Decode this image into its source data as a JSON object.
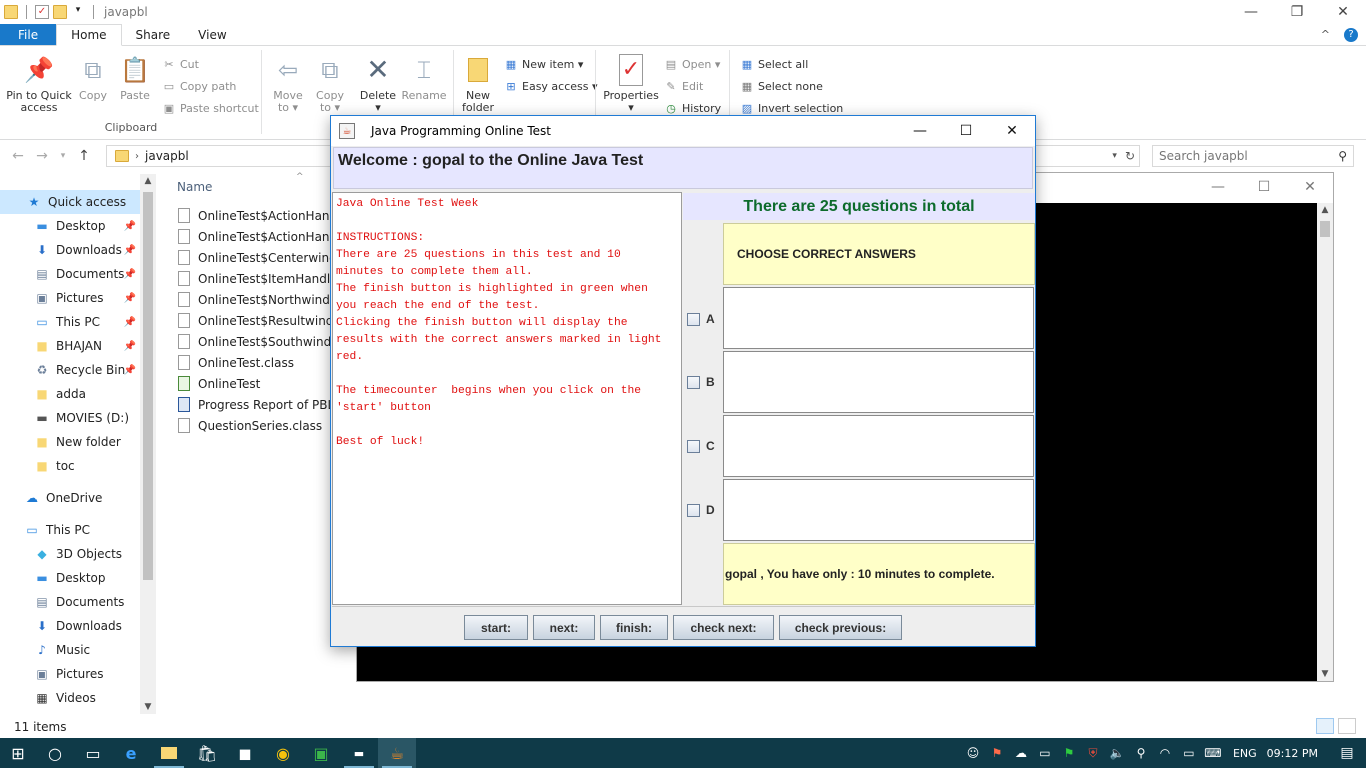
{
  "explorer": {
    "title": "javapbl",
    "tabs": [
      {
        "label": "File"
      },
      {
        "label": "Home"
      },
      {
        "label": "Share"
      },
      {
        "label": "View"
      }
    ],
    "ribbon": {
      "clipboard": {
        "label": "Clipboard",
        "pin": "Pin to Quick\naccess",
        "copy": "Copy",
        "paste": "Paste",
        "cut": "Cut",
        "copy_path": "Copy path",
        "paste_shortcut": "Paste shortcut"
      },
      "organize": {
        "move_to": "Move\nto ▾",
        "copy_to": "Copy\nto ▾",
        "delete": "Delete\n▾",
        "rename": "Rename"
      },
      "new": {
        "new_folder": "New\nfolder",
        "new_item": "New item ▾",
        "easy_access": "Easy access ▾"
      },
      "open": {
        "properties": "Properties\n▾",
        "open": "Open ▾",
        "edit": "Edit",
        "history": "History"
      },
      "select": {
        "select_all": "Select all",
        "select_none": "Select none",
        "invert_selection": "Invert selection"
      }
    },
    "address": {
      "path": "javapbl",
      "search_placeholder": "Search javapbl"
    },
    "nav": [
      {
        "label": "Quick access",
        "icon": "star-icon"
      },
      {
        "label": "Desktop",
        "icon": "desktop-icon"
      },
      {
        "label": "Downloads",
        "icon": "download-icon"
      },
      {
        "label": "Documents",
        "icon": "document-icon"
      },
      {
        "label": "Pictures",
        "icon": "pictures-icon"
      },
      {
        "label": "This PC",
        "icon": "computer-icon"
      },
      {
        "label": "BHAJAN",
        "icon": "folder-icon"
      },
      {
        "label": "Recycle Bin",
        "icon": "recycle-bin-icon"
      },
      {
        "label": "adda",
        "icon": "folder-icon"
      },
      {
        "label": "MOVIES (D:)",
        "icon": "drive-icon"
      },
      {
        "label": "New folder",
        "icon": "folder-icon"
      },
      {
        "label": "toc",
        "icon": "folder-icon"
      },
      {
        "label": "OneDrive",
        "icon": "cloud-icon"
      },
      {
        "label": "This PC",
        "icon": "computer-icon"
      },
      {
        "label": "3D Objects",
        "icon": "cube-icon"
      },
      {
        "label": "Desktop",
        "icon": "desktop-icon"
      },
      {
        "label": "Documents",
        "icon": "document-icon"
      },
      {
        "label": "Downloads",
        "icon": "download-icon"
      },
      {
        "label": "Music",
        "icon": "music-icon"
      },
      {
        "label": "Pictures",
        "icon": "pictures-icon"
      },
      {
        "label": "Videos",
        "icon": "video-icon"
      }
    ],
    "column_name": "Name",
    "files": [
      "OnlineTest$ActionHandle",
      "OnlineTest$ActionHandle",
      "OnlineTest$Centerwindo",
      "OnlineTest$ItemHandler.",
      "OnlineTest$Northwindow",
      "OnlineTest$Resultwindov",
      "OnlineTest$Southwindov",
      "OnlineTest.class",
      "OnlineTest",
      "Progress Report of PBL",
      "QuestionSeries.class"
    ],
    "status": "11 items"
  },
  "java": {
    "title": "Java Programming Online Test",
    "welcome": "Welcome : gopal  to the Online Java Test",
    "instructions": "Java Online Test Week\n\nINSTRUCTIONS:\nThere are 25 questions in this test and 10\nminutes to complete them all.\nThe finish button is highlighted in green when\nyou reach the end of the test.\nClicking the finish button will display the\nresults with the correct answers marked in light\nred.\n\nThe timecounter  begins when you click on the\n'start' button\n\nBest of luck!",
    "total": "There are 25 questions in total",
    "question": "CHOOSE CORRECT ANSWERS",
    "options": [
      "A",
      "B",
      "C",
      "D"
    ],
    "time_msg": "gopal ,   You have only : 10 minutes to complete.",
    "buttons": {
      "start": "start:",
      "next": "next:",
      "finish": "finish:",
      "check_next": "check next:",
      "check_previous": "check previous:"
    }
  },
  "taskbar": {
    "lang": "ENG",
    "time": "09:12 PM"
  }
}
